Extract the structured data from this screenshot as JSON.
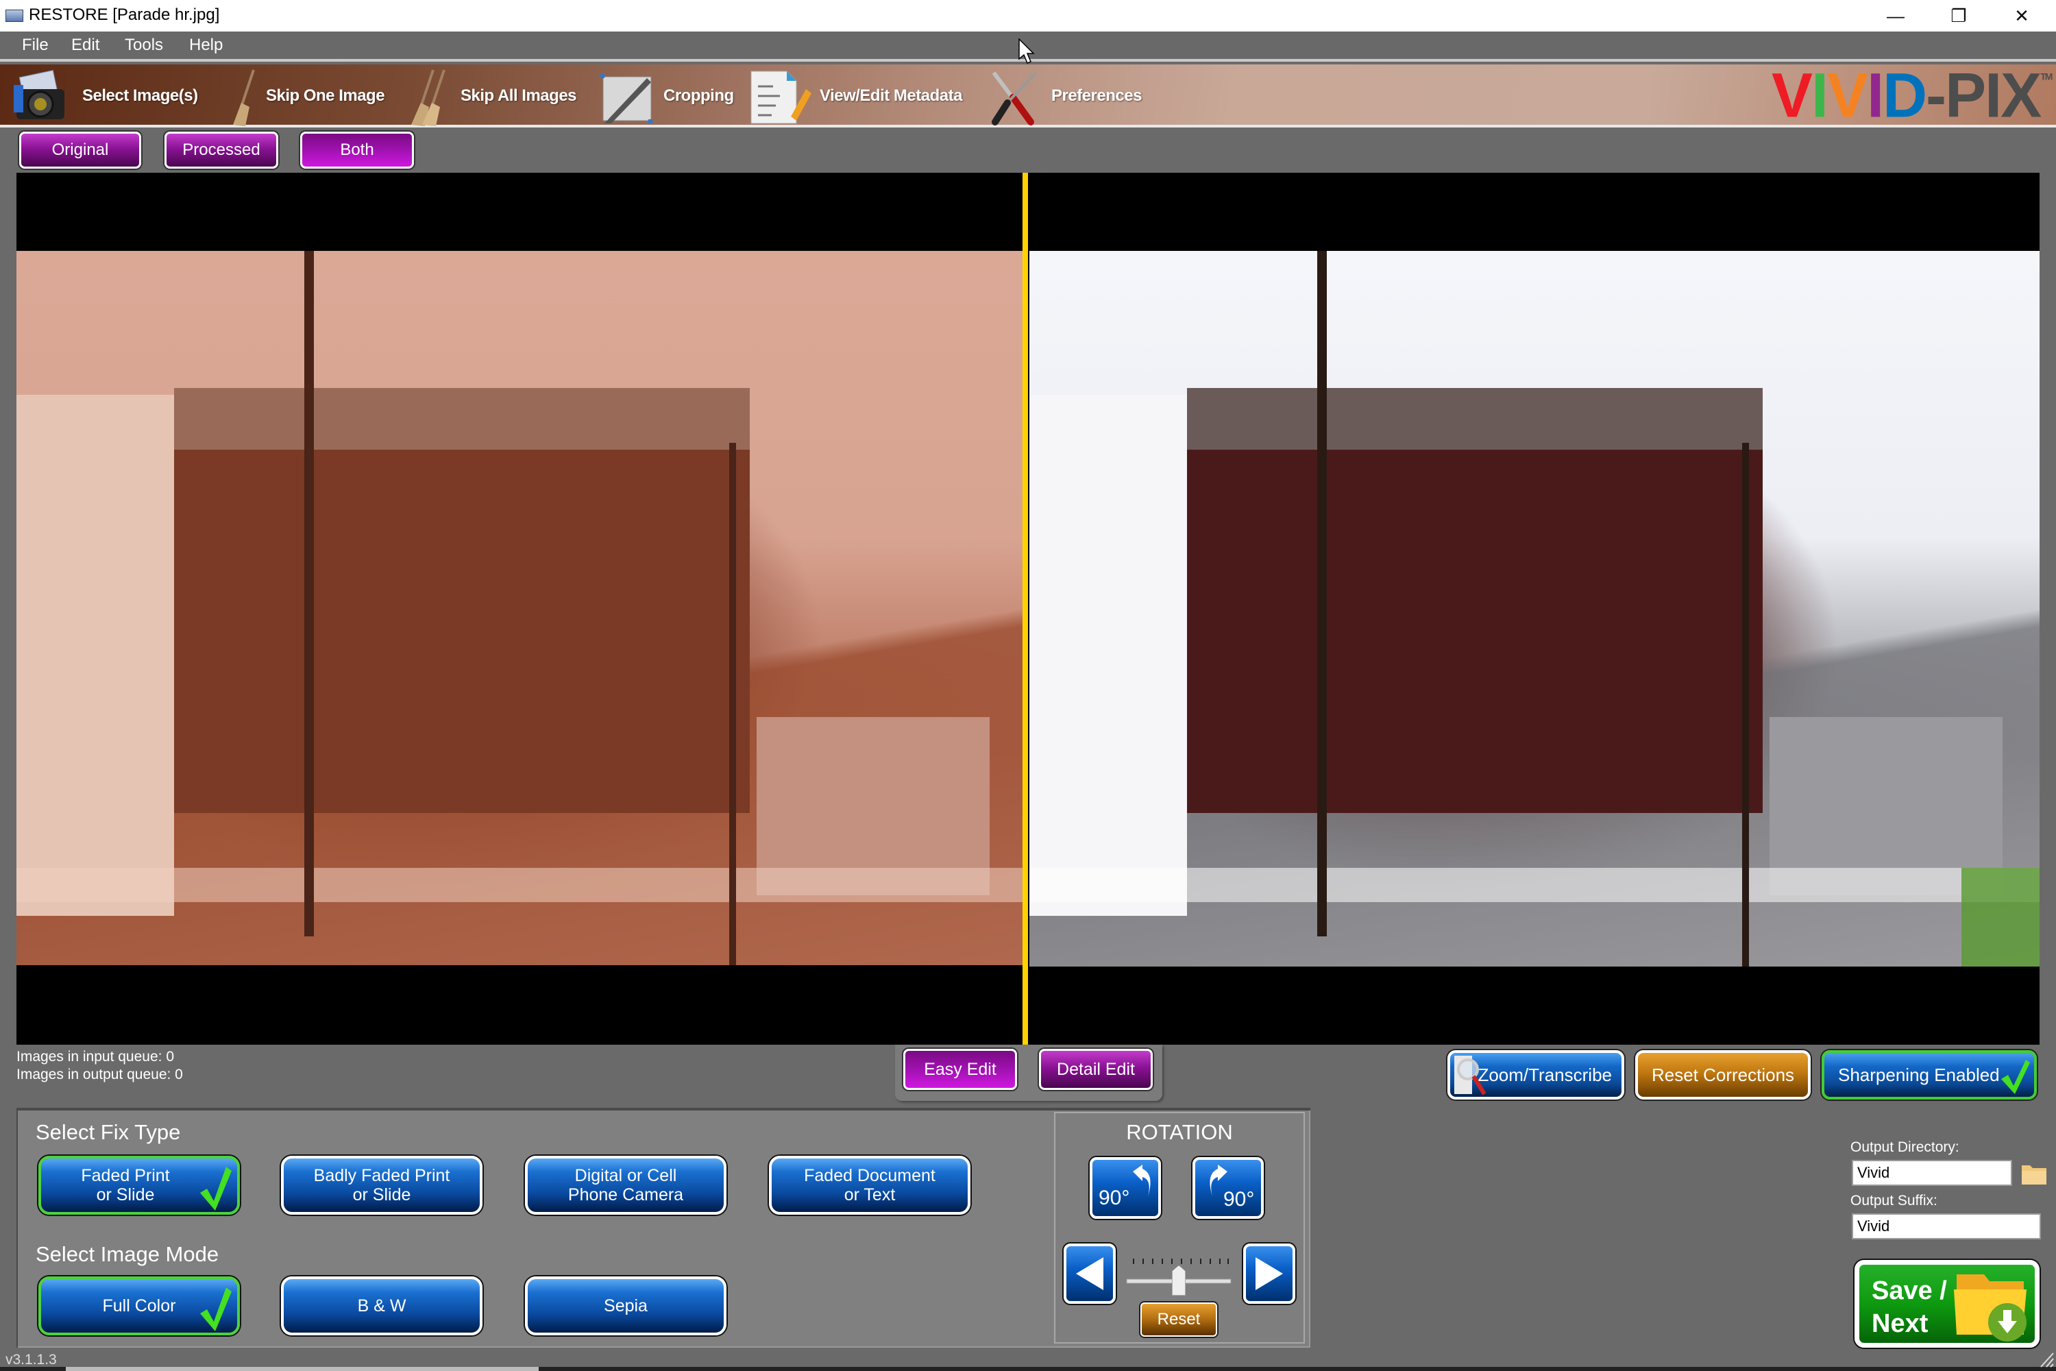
{
  "window": {
    "title": "RESTORE  [Parade hr.jpg]",
    "controls": {
      "minimize": "—",
      "restore": "❐",
      "close": "✕"
    }
  },
  "menu": [
    "File",
    "Edit",
    "Tools",
    "Help"
  ],
  "toolbar": {
    "items": [
      {
        "label": "Select Image(s)",
        "icon": "camera-icon"
      },
      {
        "label": "Skip One Image",
        "icon": "broom-icon"
      },
      {
        "label": "Skip All Images",
        "icon": "brooms-icon"
      },
      {
        "label": "Cropping",
        "icon": "crop-icon"
      },
      {
        "label": "View/Edit Metadata",
        "icon": "document-pencil-icon"
      },
      {
        "label": "Preferences",
        "icon": "tools-icon"
      }
    ],
    "logo": {
      "letters": [
        "V",
        "I",
        "V",
        "I",
        "D",
        "-",
        "P",
        "I",
        "X"
      ],
      "colors": [
        "#ee1c24",
        "#3cb64a",
        "#f58220",
        "#92278f",
        "#0072bc",
        "#4d4d4d",
        "#4d4d4d",
        "#4d4d4d",
        "#4d4d4d"
      ],
      "tm": "TM"
    }
  },
  "view_buttons": [
    {
      "label": "Original",
      "active": false
    },
    {
      "label": "Processed",
      "active": false
    },
    {
      "label": "Both",
      "active": true
    }
  ],
  "viewer": {
    "left_image": "original-photo",
    "right_image": "processed-photo",
    "divider_color": "#ffd200"
  },
  "queue": {
    "input": "Images in input queue:  0",
    "output": "Images in output queue: 0"
  },
  "edit_tabs": [
    {
      "label": "Easy Edit",
      "active": true
    },
    {
      "label": "Detail Edit",
      "active": false
    }
  ],
  "actions": {
    "zoom_transcribe": "Zoom/Transcribe",
    "reset_corrections": "Reset Corrections",
    "sharpening": "Sharpening Enabled",
    "sharpening_enabled": true
  },
  "fix_type": {
    "label": "Select Fix Type",
    "options": [
      {
        "line1": "Faded Print",
        "line2": "or Slide",
        "selected": true
      },
      {
        "line1": "Badly Faded Print",
        "line2": "or Slide",
        "selected": false
      },
      {
        "line1": "Digital or Cell",
        "line2": "Phone Camera",
        "selected": false
      },
      {
        "line1": "Faded Document",
        "line2": "or Text",
        "selected": false
      }
    ]
  },
  "image_mode": {
    "label": "Select Image Mode",
    "options": [
      {
        "label": "Full Color",
        "selected": true
      },
      {
        "label": "B & W",
        "selected": false
      },
      {
        "label": "Sepia",
        "selected": false
      }
    ]
  },
  "rotation": {
    "title": "ROTATION",
    "ccw_label": "90°",
    "cw_label": "90°",
    "slider_value": 0.5,
    "reset": "Reset"
  },
  "output": {
    "directory_label": "Output Directory:",
    "directory_value": "Vivid",
    "suffix_label": "Output Suffix:",
    "suffix_value": "Vivid",
    "save_line1": "Save /",
    "save_line2": "Next"
  },
  "version": "v3.1.1.3"
}
